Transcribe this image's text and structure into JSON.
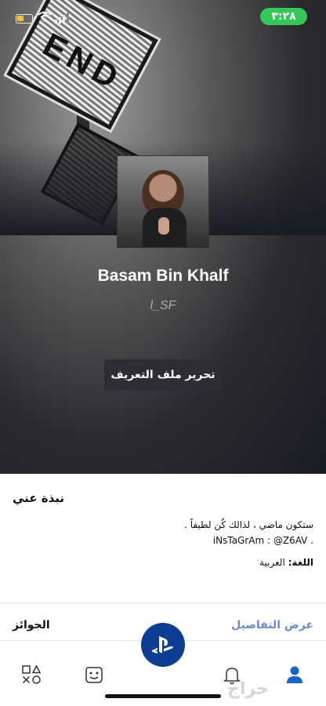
{
  "status_bar": {
    "time": "٣:٢٨",
    "battery_level": 0.45
  },
  "cover": {
    "sign_text": "END"
  },
  "profile": {
    "name": "Basam Bin Khalf",
    "handle": "l_SF",
    "edit_button": "تحرير ملف التعريف"
  },
  "about": {
    "title": "نبذة عني",
    "bio_line1": "ستكون ماضي ، لذالك كُن لطيفاً .",
    "bio_line2": "iNsTaGrAm : @Z6AV .",
    "language_label": "اللغة:",
    "language_value": "العربية"
  },
  "trophies": {
    "title": "الجوائز",
    "details_link": "عرض التفاصيل"
  },
  "nav": {
    "items": [
      {
        "name": "games",
        "icon": "ps-shapes-icon"
      },
      {
        "name": "friends",
        "icon": "friends-face-icon"
      },
      {
        "name": "playstation",
        "icon": "playstation-logo-icon"
      },
      {
        "name": "notifications",
        "icon": "bell-icon"
      },
      {
        "name": "profile",
        "icon": "person-icon"
      }
    ]
  },
  "watermark": "حراج",
  "colors": {
    "accent": "#0e3e94",
    "link": "#6a88d8",
    "status_time_bg": "#34c759"
  }
}
